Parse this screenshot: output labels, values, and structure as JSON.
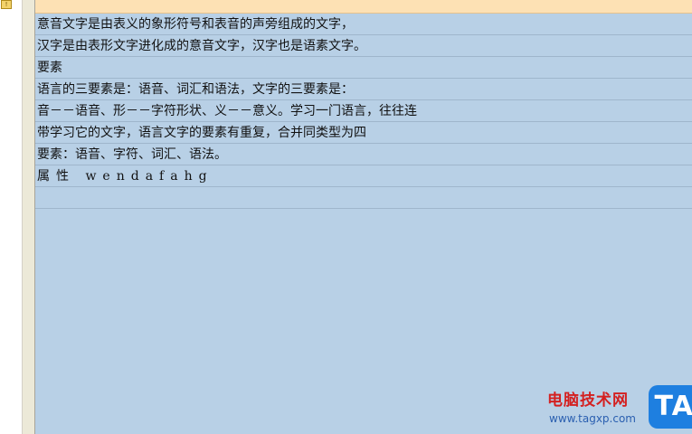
{
  "left_panel": {
    "warning_icon": "warning-icon"
  },
  "editor": {
    "lines": [
      "意音文字是由表义的象形符号和表音的声旁组成的文字，",
      "汉字是由表形文字进化成的意音文字，汉字也是语素文字。",
      "要素",
      "语言的三要素是：语音、词汇和语法，文字的三要素是：",
      "音－－语音、形－－字符形状、义－－意义。学习一门语言，往往连",
      "带学习它的文字，语言文字的要素有重复，合并同类型为四",
      "要素：语音、字符、词汇、语法。",
      "属性 wendafahg",
      ""
    ]
  },
  "watermark": {
    "title": "电脑技术网",
    "url": "www.tagxp.com",
    "tag": "TAG"
  },
  "colors": {
    "editor_bg": "#b8d0e6",
    "topbar_bg": "#fde1b4",
    "tag_blue": "#1e7fe0",
    "watermark_red": "#d42020"
  }
}
